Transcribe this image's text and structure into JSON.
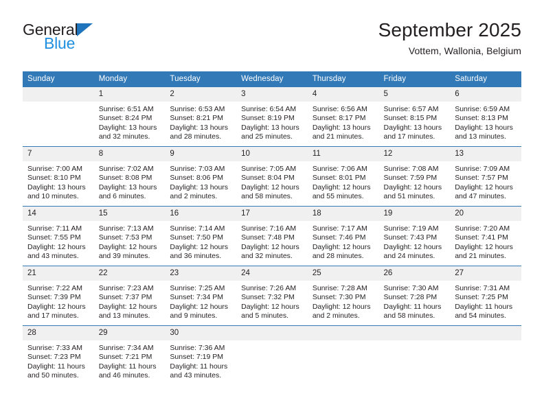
{
  "logo": {
    "text_primary": "General",
    "text_secondary": "Blue",
    "triangle_icon": "blue-triangle-icon"
  },
  "header": {
    "title": "September 2025",
    "subtitle": "Vottem, Wallonia, Belgium"
  },
  "colors": {
    "header_blue": "#3279b7",
    "logo_blue": "#1f8fe0",
    "logo_triangle": "#1f74bb",
    "daynum_band": "#f0f0f0",
    "text": "#231f20"
  },
  "calendar": {
    "weekday_headers": [
      "Sunday",
      "Monday",
      "Tuesday",
      "Wednesday",
      "Thursday",
      "Friday",
      "Saturday"
    ],
    "weeks": [
      [
        {
          "empty": true
        },
        {
          "day": "1",
          "sunrise": "Sunrise: 6:51 AM",
          "sunset": "Sunset: 8:24 PM",
          "daylight1": "Daylight: 13 hours",
          "daylight2": "and 32 minutes."
        },
        {
          "day": "2",
          "sunrise": "Sunrise: 6:53 AM",
          "sunset": "Sunset: 8:21 PM",
          "daylight1": "Daylight: 13 hours",
          "daylight2": "and 28 minutes."
        },
        {
          "day": "3",
          "sunrise": "Sunrise: 6:54 AM",
          "sunset": "Sunset: 8:19 PM",
          "daylight1": "Daylight: 13 hours",
          "daylight2": "and 25 minutes."
        },
        {
          "day": "4",
          "sunrise": "Sunrise: 6:56 AM",
          "sunset": "Sunset: 8:17 PM",
          "daylight1": "Daylight: 13 hours",
          "daylight2": "and 21 minutes."
        },
        {
          "day": "5",
          "sunrise": "Sunrise: 6:57 AM",
          "sunset": "Sunset: 8:15 PM",
          "daylight1": "Daylight: 13 hours",
          "daylight2": "and 17 minutes."
        },
        {
          "day": "6",
          "sunrise": "Sunrise: 6:59 AM",
          "sunset": "Sunset: 8:13 PM",
          "daylight1": "Daylight: 13 hours",
          "daylight2": "and 13 minutes."
        }
      ],
      [
        {
          "day": "7",
          "sunrise": "Sunrise: 7:00 AM",
          "sunset": "Sunset: 8:10 PM",
          "daylight1": "Daylight: 13 hours",
          "daylight2": "and 10 minutes."
        },
        {
          "day": "8",
          "sunrise": "Sunrise: 7:02 AM",
          "sunset": "Sunset: 8:08 PM",
          "daylight1": "Daylight: 13 hours",
          "daylight2": "and 6 minutes."
        },
        {
          "day": "9",
          "sunrise": "Sunrise: 7:03 AM",
          "sunset": "Sunset: 8:06 PM",
          "daylight1": "Daylight: 13 hours",
          "daylight2": "and 2 minutes."
        },
        {
          "day": "10",
          "sunrise": "Sunrise: 7:05 AM",
          "sunset": "Sunset: 8:04 PM",
          "daylight1": "Daylight: 12 hours",
          "daylight2": "and 58 minutes."
        },
        {
          "day": "11",
          "sunrise": "Sunrise: 7:06 AM",
          "sunset": "Sunset: 8:01 PM",
          "daylight1": "Daylight: 12 hours",
          "daylight2": "and 55 minutes."
        },
        {
          "day": "12",
          "sunrise": "Sunrise: 7:08 AM",
          "sunset": "Sunset: 7:59 PM",
          "daylight1": "Daylight: 12 hours",
          "daylight2": "and 51 minutes."
        },
        {
          "day": "13",
          "sunrise": "Sunrise: 7:09 AM",
          "sunset": "Sunset: 7:57 PM",
          "daylight1": "Daylight: 12 hours",
          "daylight2": "and 47 minutes."
        }
      ],
      [
        {
          "day": "14",
          "sunrise": "Sunrise: 7:11 AM",
          "sunset": "Sunset: 7:55 PM",
          "daylight1": "Daylight: 12 hours",
          "daylight2": "and 43 minutes."
        },
        {
          "day": "15",
          "sunrise": "Sunrise: 7:13 AM",
          "sunset": "Sunset: 7:53 PM",
          "daylight1": "Daylight: 12 hours",
          "daylight2": "and 39 minutes."
        },
        {
          "day": "16",
          "sunrise": "Sunrise: 7:14 AM",
          "sunset": "Sunset: 7:50 PM",
          "daylight1": "Daylight: 12 hours",
          "daylight2": "and 36 minutes."
        },
        {
          "day": "17",
          "sunrise": "Sunrise: 7:16 AM",
          "sunset": "Sunset: 7:48 PM",
          "daylight1": "Daylight: 12 hours",
          "daylight2": "and 32 minutes."
        },
        {
          "day": "18",
          "sunrise": "Sunrise: 7:17 AM",
          "sunset": "Sunset: 7:46 PM",
          "daylight1": "Daylight: 12 hours",
          "daylight2": "and 28 minutes."
        },
        {
          "day": "19",
          "sunrise": "Sunrise: 7:19 AM",
          "sunset": "Sunset: 7:43 PM",
          "daylight1": "Daylight: 12 hours",
          "daylight2": "and 24 minutes."
        },
        {
          "day": "20",
          "sunrise": "Sunrise: 7:20 AM",
          "sunset": "Sunset: 7:41 PM",
          "daylight1": "Daylight: 12 hours",
          "daylight2": "and 21 minutes."
        }
      ],
      [
        {
          "day": "21",
          "sunrise": "Sunrise: 7:22 AM",
          "sunset": "Sunset: 7:39 PM",
          "daylight1": "Daylight: 12 hours",
          "daylight2": "and 17 minutes."
        },
        {
          "day": "22",
          "sunrise": "Sunrise: 7:23 AM",
          "sunset": "Sunset: 7:37 PM",
          "daylight1": "Daylight: 12 hours",
          "daylight2": "and 13 minutes."
        },
        {
          "day": "23",
          "sunrise": "Sunrise: 7:25 AM",
          "sunset": "Sunset: 7:34 PM",
          "daylight1": "Daylight: 12 hours",
          "daylight2": "and 9 minutes."
        },
        {
          "day": "24",
          "sunrise": "Sunrise: 7:26 AM",
          "sunset": "Sunset: 7:32 PM",
          "daylight1": "Daylight: 12 hours",
          "daylight2": "and 5 minutes."
        },
        {
          "day": "25",
          "sunrise": "Sunrise: 7:28 AM",
          "sunset": "Sunset: 7:30 PM",
          "daylight1": "Daylight: 12 hours",
          "daylight2": "and 2 minutes."
        },
        {
          "day": "26",
          "sunrise": "Sunrise: 7:30 AM",
          "sunset": "Sunset: 7:28 PM",
          "daylight1": "Daylight: 11 hours",
          "daylight2": "and 58 minutes."
        },
        {
          "day": "27",
          "sunrise": "Sunrise: 7:31 AM",
          "sunset": "Sunset: 7:25 PM",
          "daylight1": "Daylight: 11 hours",
          "daylight2": "and 54 minutes."
        }
      ],
      [
        {
          "day": "28",
          "sunrise": "Sunrise: 7:33 AM",
          "sunset": "Sunset: 7:23 PM",
          "daylight1": "Daylight: 11 hours",
          "daylight2": "and 50 minutes."
        },
        {
          "day": "29",
          "sunrise": "Sunrise: 7:34 AM",
          "sunset": "Sunset: 7:21 PM",
          "daylight1": "Daylight: 11 hours",
          "daylight2": "and 46 minutes."
        },
        {
          "day": "30",
          "sunrise": "Sunrise: 7:36 AM",
          "sunset": "Sunset: 7:19 PM",
          "daylight1": "Daylight: 11 hours",
          "daylight2": "and 43 minutes."
        },
        {
          "empty": true
        },
        {
          "empty": true
        },
        {
          "empty": true
        },
        {
          "empty": true
        }
      ]
    ]
  }
}
